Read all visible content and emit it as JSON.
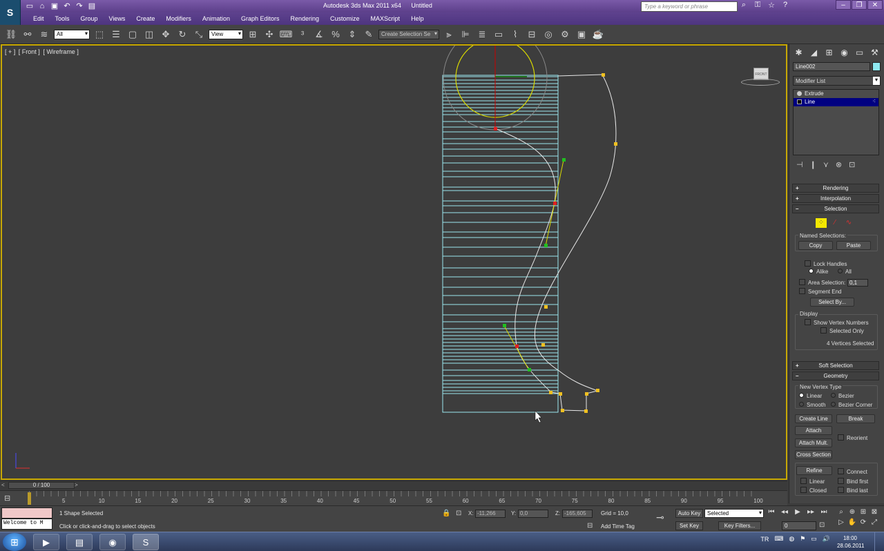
{
  "title": {
    "app": "Autodesk 3ds Max  2011 x64",
    "file": "Untitled"
  },
  "search": {
    "placeholder": "Type a keyword or phrase"
  },
  "menu": [
    "Edit",
    "Tools",
    "Group",
    "Views",
    "Create",
    "Modifiers",
    "Animation",
    "Graph Editors",
    "Rendering",
    "Customize",
    "MAXScript",
    "Help"
  ],
  "toolbar": {
    "filter": "All",
    "refcoord": "View",
    "named_sel": "Create Selection Se"
  },
  "viewport": {
    "label_plus": "[ + ]",
    "label_view": "[ Front ]",
    "label_shading": "[ Wireframe ]",
    "viewcube_face": "FRONT"
  },
  "panel": {
    "object_name": "Line002",
    "object_color": "#8ee8f0",
    "modifier_list": "Modifier List",
    "stack": [
      "Extrude",
      "Line"
    ],
    "rollouts": {
      "rendering": "Rendering",
      "interpolation": "Interpolation",
      "selection": "Selection",
      "soft_selection": "Soft Selection",
      "geometry": "Geometry"
    },
    "named_selections": "Named Selections:",
    "copy": "Copy",
    "paste": "Paste",
    "lock_handles": "Lock Handles",
    "alike": "Alike",
    "all": "All",
    "area_selection": "Area Selection:",
    "area_value": "0,1",
    "segment_end": "Segment End",
    "select_by": "Select By...",
    "display": "Display",
    "show_vertex_numbers": "Show Vertex Numbers",
    "selected_only": "Selected Only",
    "vertices_selected": "4 Vertices Selected",
    "new_vertex_type": "New Vertex Type",
    "linear": "Linear",
    "bezier": "Bezier",
    "smooth": "Smooth",
    "bezier_corner": "Bezier Corner",
    "create_line": "Create Line",
    "break": "Break",
    "attach": "Attach",
    "attach_mult": "Attach Mult.",
    "reorient": "Reorient",
    "cross_section": "Cross Section",
    "refine": "Refine",
    "connect": "Connect",
    "refine_linear": "Linear",
    "bind_first": "Bind first",
    "closed": "Closed",
    "bind_last": "Bind last"
  },
  "timeslider": {
    "position": "0 / 100"
  },
  "track_ticks": [
    "5",
    "10",
    "15",
    "20",
    "25",
    "30",
    "35",
    "40",
    "45",
    "50",
    "55",
    "60",
    "65",
    "70",
    "75",
    "80",
    "85",
    "90",
    "95",
    "100"
  ],
  "status": {
    "maxscript": "Welcome to M",
    "selection_info": "1 Shape Selected",
    "prompt": "Click or click-and-drag to select objects",
    "x_label": "X:",
    "x_value": "-11,266",
    "y_label": "Y:",
    "y_value": "0,0",
    "z_label": "Z:",
    "z_value": "-165,605",
    "grid": "Grid = 10,0",
    "add_time_tag": "Add Time Tag",
    "auto_key": "Auto Key",
    "set_key": "Set Key",
    "selected": "Selected",
    "key_filters": "Key Filters...",
    "frame": "0"
  },
  "taskbar": {
    "lang": "TR",
    "time": "18:00",
    "date": "28.06.2011"
  }
}
